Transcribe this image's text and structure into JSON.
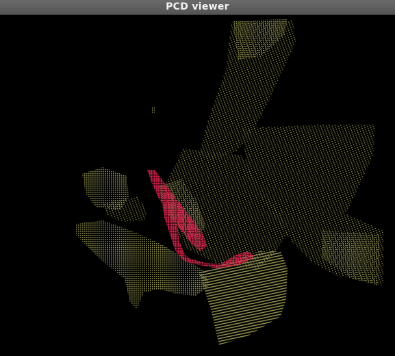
{
  "window": {
    "title": "PCD viewer"
  },
  "viewer": {
    "background": "#000000",
    "colors": {
      "scene": "#8a8a4e",
      "highlight": "#d0224a"
    }
  }
}
